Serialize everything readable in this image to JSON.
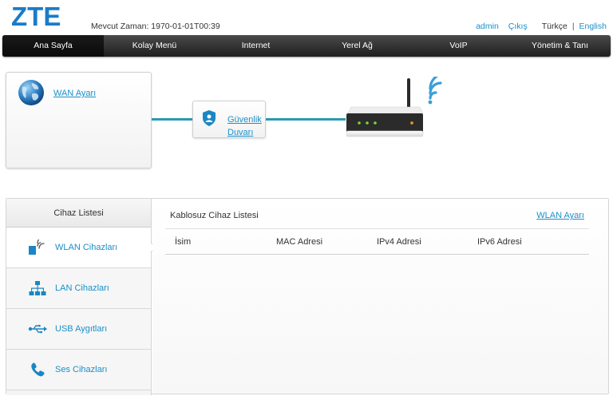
{
  "header": {
    "brand": "ZTE",
    "current_time": "Mevcut Zaman: 1970-01-01T00:39",
    "user": "admin",
    "logout": "Çıkış",
    "lang_current": "Türkçe",
    "lang_separator": "|",
    "lang_other": "English"
  },
  "nav": {
    "items": [
      {
        "label": "Ana Sayfa"
      },
      {
        "label": "Kolay Menü"
      },
      {
        "label": "Internet"
      },
      {
        "label": "Yerel Ağ"
      },
      {
        "label": "VoIP"
      },
      {
        "label": "Yönetim & Tanı"
      }
    ],
    "active_index": 0
  },
  "topology": {
    "wan_link": "WAN Ayarı",
    "firewall_link": "Güvenlik Duvarı"
  },
  "devices": {
    "sidebar_title": "Cihaz Listesi",
    "items": [
      {
        "label": "WLAN Cihazları",
        "icon": "wlan-device-icon"
      },
      {
        "label": "LAN Cihazları",
        "icon": "lan-network-icon"
      },
      {
        "label": "USB Aygıtları",
        "icon": "usb-icon"
      },
      {
        "label": "Ses Cihazları",
        "icon": "phone-icon"
      }
    ],
    "content_title": "Kablosuz Cihaz Listesi",
    "content_link": "WLAN Ayarı",
    "columns": [
      "İsim",
      "MAC Adresi",
      "IPv4 Adresi",
      "IPv6 Adresi"
    ]
  },
  "colors": {
    "accent": "#1a8fc9",
    "connector": "#2a9ab0",
    "brand_blue": "#1a7cc7"
  }
}
